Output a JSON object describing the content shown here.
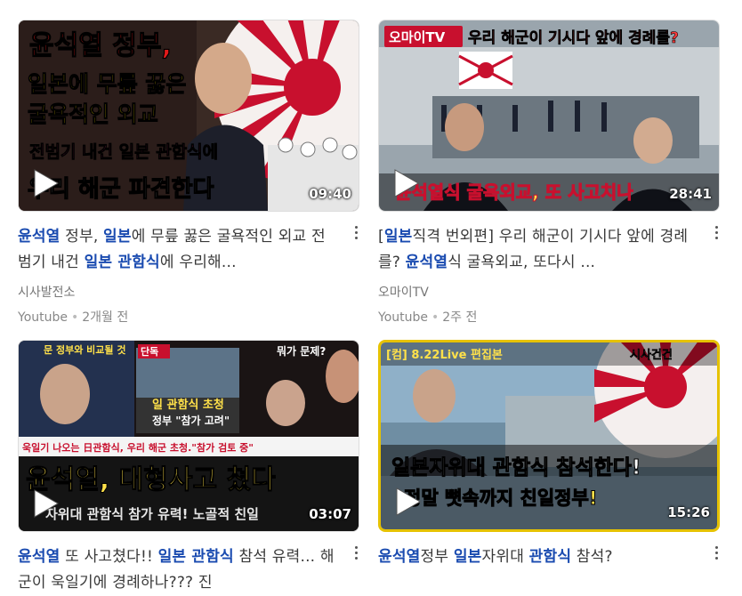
{
  "cards": [
    {
      "title_parts": [
        [
          "윤석열",
          true
        ],
        [
          " 정부, ",
          false
        ],
        [
          "일본",
          true
        ],
        [
          "에 무릎 꿇은 굴욕적인 외교 전범기 내건 ",
          false
        ],
        [
          "일본 관함식",
          true
        ],
        [
          "에 우리해...",
          false
        ]
      ],
      "channel": "시사발전소",
      "source": "Youtube",
      "age": "2개월 전",
      "duration": "09:40",
      "thumb_text": [
        "윤석열 정부,",
        "일본에 무릎 꿇은",
        "굴욕적인 외교",
        "전범기 내건 일본 관함식에",
        "우리 해군 파견한다"
      ]
    },
    {
      "title_parts": [
        [
          "[",
          false
        ],
        [
          "일본",
          true
        ],
        [
          "직격 번외편] 우리 해군이 기시다 앞에 경례를? ",
          false
        ],
        [
          "윤석열",
          true
        ],
        [
          "식 굴욕외교, 또다시 ...",
          false
        ]
      ],
      "channel": "오마이TV",
      "source": "Youtube",
      "age": "2주 전",
      "duration": "28:41",
      "thumb_text": [
        "오마이TV",
        "우리 해군이 기시다 앞에 경례를?",
        "윤석열식 굴욕외교, 또 사고치나"
      ]
    },
    {
      "title_parts": [
        [
          "윤석열",
          true
        ],
        [
          " 또 사고쳤다!! ",
          false
        ],
        [
          "일본 관함식",
          true
        ],
        [
          " 참석 유력... 해군이 욱일기에 경례하나??? 진",
          false
        ]
      ],
      "channel": "",
      "source": "Youtube",
      "age": "",
      "duration": "03:07",
      "thumb_text": [
        "문 정부와 비교될 것",
        "단독",
        "뭐가 문제?",
        "일 관함식 초청",
        "정부 \"참가 고려\"",
        "욱일기 나오는 日관함식, 우리 해군 초청.\"참가 검토 중\"",
        "윤석열, 대형사고 쳤다",
        "자위대 관함식 참가 유력! 노골적 친일"
      ]
    },
    {
      "title_parts": [
        [
          "윤석열",
          true
        ],
        [
          "정부 ",
          false
        ],
        [
          "일본",
          true
        ],
        [
          "자위대 ",
          false
        ],
        [
          "관함식",
          true
        ],
        [
          " 참석?",
          false
        ]
      ],
      "channel": "",
      "source": "Youtube",
      "age": "",
      "duration": "15:26",
      "thumb_text": [
        "[컴] 8.22Live 편집본",
        "시사건건",
        "일본자위대 관함식 참석한다!",
        "정말 뼛속까지 친일정부!"
      ]
    }
  ],
  "colors": {
    "link_blue": "#1a4bb0",
    "text": "#3a3a3a",
    "meta": "#888888"
  }
}
